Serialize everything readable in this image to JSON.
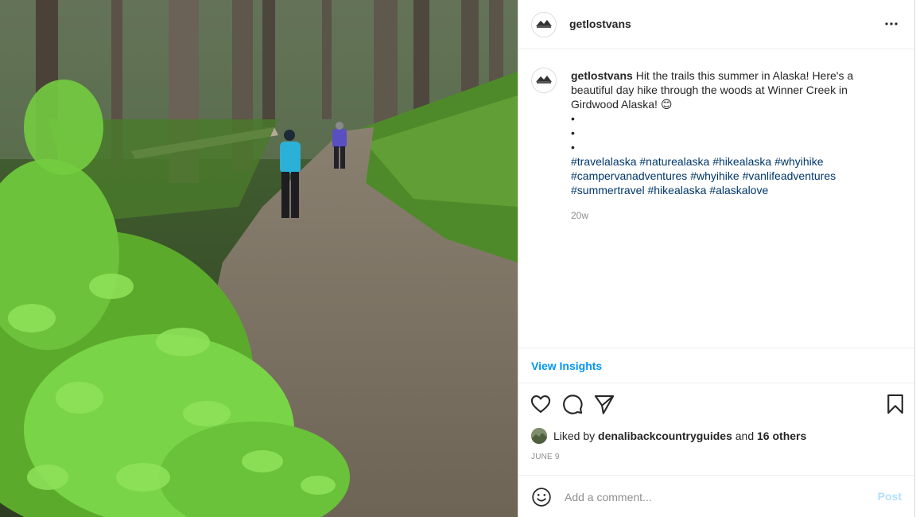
{
  "post": {
    "author": "getlostvans",
    "caption_text": "Hit the trails this summer in Alaska! Here's a beautiful day hike through the woods at Winner Creek in Girdwood Alaska! 😊",
    "bullets": [
      "•",
      "•",
      "•"
    ],
    "hashtags": [
      "#travelalaska",
      "#naturealaska",
      "#hikealaska",
      "#whyihike",
      "#campervanadventures",
      "#whyihike",
      "#vanlifeadventures",
      "#summertravel",
      "#hikealaska",
      "#alaskalove"
    ],
    "time_ago": "20w",
    "view_insights": "View Insights",
    "liked_by_prefix": "Liked by",
    "liked_by_user": "denalibackcountryguides",
    "liked_by_and": "and",
    "liked_by_others": "16 others",
    "date": "JUNE 9"
  },
  "icons": {
    "more": "more-horizontal-icon",
    "like": "heart-icon",
    "comment": "comment-bubble-icon",
    "share": "paper-plane-icon",
    "save": "bookmark-icon",
    "emoji": "smiley-icon"
  },
  "comment": {
    "placeholder": "Add a comment...",
    "post_label": "Post"
  },
  "colors": {
    "link": "#00376b",
    "accent": "#0095f6",
    "post_disabled": "#b2dffc",
    "muted": "#8e8e8e"
  }
}
